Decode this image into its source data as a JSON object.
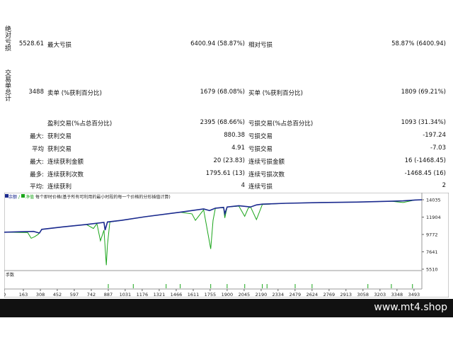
{
  "report": {
    "abs_drawdown": {
      "heading": "绝对亏损",
      "value": "5528.61",
      "max_label": "最大亏损",
      "max_value": "6400.94 (58.87%)",
      "rel_label": "相对亏损",
      "rel_value": "58.87% (6400.94)"
    },
    "trades": {
      "heading": "交易单总计",
      "total": "3488",
      "short_label": "卖单 (%获利百分比)",
      "short_value": "1679 (68.08%)",
      "long_label": "买单 (%获利百分比)",
      "long_value": "1809 (69.21%)"
    },
    "profit_trades_label": "盈利交易(%占总百分比)",
    "profit_trades_value": "2395 (68.66%)",
    "loss_trades_label": "亏损交易(%占总百分比)",
    "loss_trades_value": "1093 (31.34%)",
    "largest": {
      "prefix": "最大:",
      "profit_label": "获利交易",
      "profit_value": "880.38",
      "loss_label": "亏损交易",
      "loss_value": "-197.24"
    },
    "average": {
      "prefix": "平均",
      "profit_label": "获利交易",
      "profit_value": "4.91",
      "loss_label": "亏损交易",
      "loss_value": "-7.03"
    },
    "max_consec": {
      "prefix": "最大:",
      "wins_label": "连续获利金额",
      "wins_value": "20 (23.83)",
      "losses_label": "连续亏损金额",
      "losses_value": "16 (-1468.45)"
    },
    "maximal": {
      "prefix": "最多:",
      "profit_label": "连续获利次数",
      "profit_value": "1795.61 (13)",
      "loss_label": "连续亏损次数",
      "loss_value": "-1468.45 (16)"
    },
    "avg_consec": {
      "prefix": "平均:",
      "wins_label": "连续获利",
      "wins_value": "4",
      "losses_label": "连续亏损",
      "losses_value": "2"
    }
  },
  "chart_data": {
    "type": "line",
    "legend": {
      "balance_label": "余额",
      "equity_label": "净值",
      "note": "每个即时价格(基于所有可利用的最小时段的每一个价格的分形插值计算)"
    },
    "volume_label": "手数",
    "y_ticks": [
      "14035",
      "11904",
      "9772",
      "7641",
      "5510"
    ],
    "x_ticks": [
      "0",
      "163",
      "308",
      "452",
      "597",
      "742",
      "887",
      "1031",
      "1176",
      "1321",
      "1466",
      "1611",
      "1755",
      "1900",
      "2045",
      "2190",
      "2334",
      "2479",
      "2624",
      "2769",
      "2913",
      "3058",
      "3203",
      "3348",
      "3493"
    ],
    "ylim": [
      5510,
      14035
    ],
    "xlim": [
      0,
      3560
    ],
    "series": [
      {
        "name": "余额",
        "color": "#1b2a8f",
        "x": [
          0,
          250,
          300,
          320,
          500,
          700,
          850,
          860,
          880,
          1000,
          1200,
          1500,
          1700,
          1750,
          1800,
          1870,
          1880,
          1900,
          2000,
          2100,
          2150,
          2200,
          2400,
          2700,
          3000,
          3300,
          3400,
          3500,
          3560
        ],
        "values": [
          10050,
          10150,
          9950,
          10400,
          10700,
          11000,
          11250,
          10300,
          11300,
          11500,
          11950,
          12500,
          12900,
          12700,
          13000,
          13100,
          12300,
          13150,
          13300,
          13150,
          13400,
          13500,
          13600,
          13700,
          13750,
          13850,
          13900,
          14000,
          14035
        ]
      },
      {
        "name": "净值",
        "color": "#1aa51a",
        "x": [
          0,
          200,
          230,
          260,
          290,
          320,
          500,
          700,
          760,
          790,
          820,
          850,
          870,
          880,
          900,
          950,
          1000,
          1200,
          1500,
          1600,
          1630,
          1700,
          1760,
          1780,
          1800,
          1870,
          1880,
          1900,
          2000,
          2050,
          2080,
          2100,
          2150,
          2200,
          2400,
          2700,
          3000,
          3300,
          3400,
          3500,
          3560
        ],
        "values": [
          10050,
          10000,
          9300,
          9500,
          9800,
          10400,
          10700,
          11000,
          10500,
          11100,
          9000,
          10300,
          6000,
          8500,
          11300,
          11400,
          11500,
          11950,
          12500,
          12300,
          11500,
          12800,
          8000,
          11500,
          13000,
          13050,
          11800,
          13150,
          13250,
          12000,
          13000,
          13150,
          11600,
          13450,
          13600,
          13700,
          13750,
          13850,
          13700,
          14000,
          14035
        ]
      }
    ],
    "volume_spikes_x": [
      887,
      1100,
      1380,
      1500,
      1760,
      1900,
      2050,
      2200,
      2240,
      2480,
      2624,
      3100,
      3300,
      3480
    ]
  },
  "colors": {
    "balance": "#1b2a8f",
    "equity": "#1aa51a",
    "footer_bg": "#111111"
  },
  "footer": {
    "watermark": "www.mt4.shop"
  }
}
